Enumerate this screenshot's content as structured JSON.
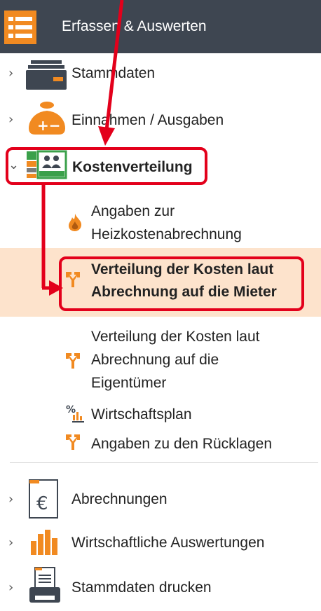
{
  "header": {
    "title": "Erfassen & Auswerten",
    "menu_icon": "list-icon"
  },
  "nav": {
    "stammdaten": {
      "label": "Stammdaten",
      "icon": "drawer-icon"
    },
    "einnahmen": {
      "label": "Einnahmen / Ausgaben",
      "icon": "money-bag-icon"
    },
    "kostenverteilung": {
      "label": "Kostenverteilung",
      "icon": "distribution-icon"
    },
    "sub": {
      "heiz": {
        "line1": "Angaben zur",
        "line2": "Heizkostenabrechnung",
        "icon": "flame-icon"
      },
      "mieter": {
        "line1": "Verteilung der Kosten laut",
        "line2": "Abrechnung auf die Mieter",
        "icon": "split-arrow-icon"
      },
      "eigentuemer": {
        "line1": "Verteilung der Kosten laut",
        "line2": "Abrechnung auf die",
        "line3": "Eigentümer",
        "icon": "split-arrow-icon"
      },
      "wirtschaftsplan": {
        "label": "Wirtschaftsplan",
        "icon": "percent-chart-icon"
      },
      "ruecklagen": {
        "label": "Angaben zu den Rücklagen",
        "icon": "split-arrow-icon"
      }
    },
    "abrechnungen": {
      "label": "Abrechnungen",
      "icon": "euro-document-icon"
    },
    "auswertungen": {
      "label": "Wirtschaftliche Auswertungen",
      "icon": "bar-chart-icon"
    },
    "drucken": {
      "label": "Stammdaten drucken",
      "icon": "printer-icon"
    }
  },
  "chevrons": {
    "collapsed": "›",
    "expanded": "⌄"
  },
  "colors": {
    "header": "#3e4651",
    "accent": "#f18a21",
    "active_bg": "#fde3cc",
    "annotation": "#e3001b"
  }
}
